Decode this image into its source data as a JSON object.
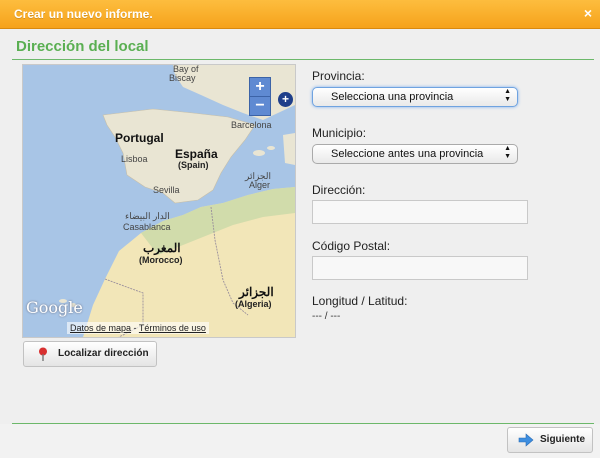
{
  "window": {
    "title": "Crear un nuevo informe.",
    "close_glyph": "×"
  },
  "section": {
    "title": "Dirección del local"
  },
  "map": {
    "labels": {
      "bay_of_biscay_1": "Bay of",
      "bay_of_biscay_2": "Biscay",
      "portugal": "Portugal",
      "espana": "España",
      "spain": "(Spain)",
      "lisboa": "Lisboa",
      "sevilla": "Sevilla",
      "barcelona": "Barcelona",
      "alger_ar": "الجزائر",
      "alger": "Alger",
      "casablanca_ar": "الدار البيضاء",
      "casablanca": "Casablanca",
      "morocco_ar": "المغرب",
      "morocco": "(Morocco)",
      "algeria_ar": "الجزائر",
      "algeria": "(Algeria)"
    },
    "zoom_in": "+",
    "zoom_out": "−",
    "logo": "Google",
    "footer_data": "Datos de mapa",
    "footer_sep": " - ",
    "footer_terms": "Términos de uso",
    "colors": {
      "sea": "#a8c5e6",
      "land": "#e9e5d3",
      "desert": "#f2e6b8",
      "green": "#cbd9a8"
    }
  },
  "locate_button": {
    "label": "Localizar dirección",
    "icon": "map-pin-icon"
  },
  "form": {
    "provincia": {
      "label": "Provincia:",
      "value": "Selecciona una provincia"
    },
    "municipio": {
      "label": "Municipio:",
      "value": "Seleccione antes una provincia"
    },
    "direccion": {
      "label": "Dirección:",
      "value": ""
    },
    "codigo_postal": {
      "label": "Código Postal:",
      "value": ""
    },
    "coords": {
      "label": "Longitud / Latitud:",
      "value": "--- / ---"
    }
  },
  "next_button": {
    "label": "Siguiente",
    "icon": "arrow-right-icon"
  },
  "accent_colors": {
    "title_bar": "#f7a823",
    "section_green": "#5aaf52"
  }
}
